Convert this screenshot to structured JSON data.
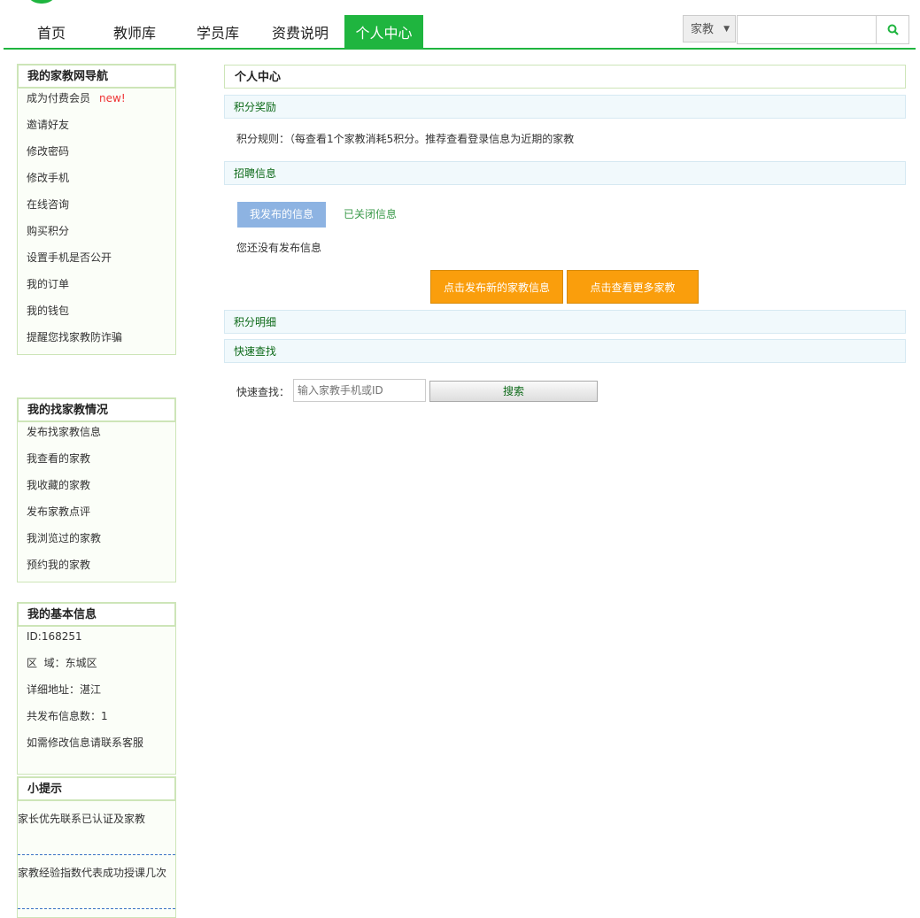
{
  "nav": {
    "items": [
      "首页",
      "教师库",
      "学员库",
      "资费说明",
      "个人中心"
    ],
    "active_index": 4
  },
  "search": {
    "type_selected": "家教",
    "input_value": ""
  },
  "sidebar": {
    "nav_box": {
      "title": "我的家教网导航",
      "items": [
        "成为付费会员",
        "邀请好友",
        "修改密码",
        "修改手机",
        "在线咨询",
        "购买积分",
        "设置手机是否公开",
        "我的订单",
        "我的钱包",
        "提醒您找家教防诈骗"
      ],
      "new_tag": "new!"
    },
    "find_box": {
      "title": "我的找家教情况",
      "items": [
        "发布找家教信息",
        "我查看的家教",
        "我收藏的家教",
        "发布家教点评",
        "我浏览过的家教",
        "预约我的家教"
      ]
    },
    "info_box": {
      "title": "我的基本信息",
      "items": [
        "ID:168251",
        "区  域：东城区",
        "详细地址：湛江",
        "共发布信息数：1",
        "如需修改信息请联系客服"
      ]
    },
    "tips_box": {
      "title": "小提示",
      "items": [
        "家长优先联系已认证及家教",
        "家教经验指数代表成功授课几次"
      ]
    }
  },
  "main": {
    "title": "个人中心",
    "points_reward": {
      "header": "积分奖励",
      "rule_text": "积分规则：（每查看1个家教消耗5积分。推荐查看登录信息为近期的家教"
    },
    "recruit": {
      "header": "招聘信息",
      "tab_active": "我发布的信息",
      "tab_closed": "已关闭信息",
      "empty_text": "您还没有发布信息",
      "btn_publish": "点击发布新的家教信息",
      "btn_more": "点击查看更多家教"
    },
    "points_detail": {
      "header": "积分明细"
    },
    "quick_search": {
      "header": "快速查找",
      "label": "快速查找：",
      "placeholder": "输入家教手机或ID",
      "button": "搜索"
    }
  },
  "colors": {
    "brand_green": "#1fb53f",
    "orange": "#fa9e0c",
    "tab_blue": "#8db3e2",
    "new_red": "#e33"
  }
}
